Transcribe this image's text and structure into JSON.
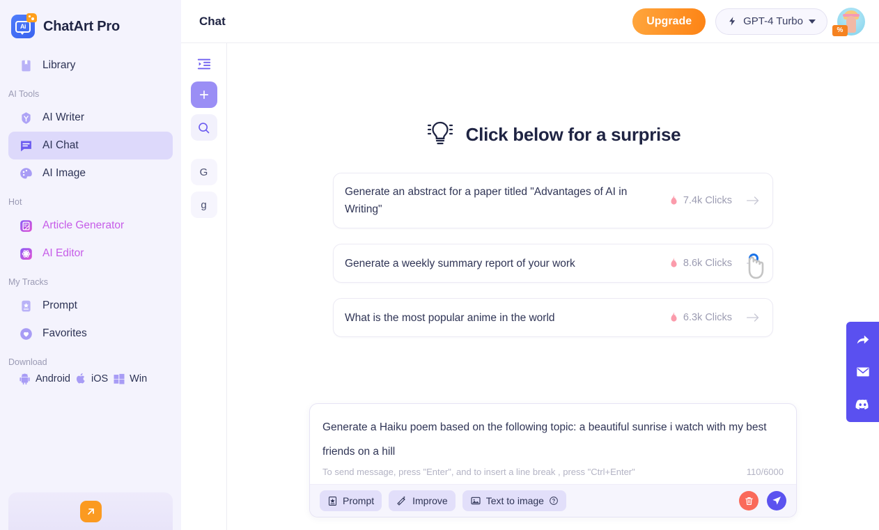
{
  "brand": {
    "name": "ChatArt Pro",
    "logo_icon": "ai-logo-icon"
  },
  "sidebar": {
    "library": {
      "label": "Library",
      "icon": "bookmark-icon"
    },
    "sections": [
      {
        "title": "AI Tools"
      },
      {
        "title": "Hot"
      },
      {
        "title": "My Tracks"
      },
      {
        "title": "Download"
      }
    ],
    "ai_tools": [
      {
        "label": "AI Writer",
        "icon": "writer-icon"
      },
      {
        "label": "AI Chat",
        "icon": "chat-bubble-icon",
        "active": true
      },
      {
        "label": "AI Image",
        "icon": "palette-icon"
      }
    ],
    "hot": [
      {
        "label": "Article Generator",
        "icon": "article-icon"
      },
      {
        "label": "AI Editor",
        "icon": "atom-icon"
      }
    ],
    "my_tracks": [
      {
        "label": "Prompt",
        "icon": "prompt-icon"
      },
      {
        "label": "Favorites",
        "icon": "heart-icon"
      }
    ],
    "download": [
      {
        "label": "Android",
        "icon": "android-icon"
      },
      {
        "label": "iOS",
        "icon": "apple-icon"
      },
      {
        "label": "Win",
        "icon": "windows-icon"
      }
    ],
    "promo": {
      "icon": "arrow-up-right-icon"
    }
  },
  "topbar": {
    "title": "Chat",
    "upgrade_label": "Upgrade",
    "model": {
      "label": "GPT-4 Turbo",
      "icon": "lightning-icon",
      "caret": "chevron-down-icon"
    },
    "avatar": {
      "name": "avatar",
      "badge": "%"
    }
  },
  "rail": {
    "collapse_icon": "collapse-panel-icon",
    "new_chat_icon": "plus-icon",
    "search_icon": "search-icon",
    "history": [
      {
        "label": "G"
      },
      {
        "label": "g"
      }
    ]
  },
  "main": {
    "heading": {
      "icon": "lightbulb-icon",
      "title": "Click below for a surprise"
    },
    "suggestions": [
      {
        "text": "Generate an abstract for a paper titled \"Advantages of AI in Writing\"",
        "clicks": "7.4k Clicks",
        "fire_icon": "flame-icon",
        "arrow_icon": "arrow-right-icon"
      },
      {
        "text": "Generate a weekly summary report of your work",
        "clicks": "8.6k Clicks",
        "fire_icon": "flame-icon",
        "arrow_icon": "arrow-right-icon"
      },
      {
        "text": "What is the most popular anime in the world",
        "clicks": "6.3k Clicks",
        "fire_icon": "flame-icon",
        "arrow_icon": "arrow-right-icon"
      }
    ]
  },
  "composer": {
    "value": "Generate a Haiku poem based on the following topic: a beautiful sunrise i watch with my best friends on a hill",
    "hint": "To send message, press \"Enter\", and to insert a line break , press \"Ctrl+Enter\"",
    "counter": "110/6000",
    "tools": [
      {
        "label": "Prompt",
        "icon": "prompt-box-icon"
      },
      {
        "label": "Improve",
        "icon": "magic-wand-icon"
      },
      {
        "label": "Text to image",
        "icon": "image-icon",
        "help_icon": "question-mark-icon"
      }
    ],
    "delete_icon": "trash-icon",
    "send_icon": "send-icon"
  },
  "dock": [
    {
      "icon": "share-icon"
    },
    {
      "icon": "mail-icon"
    },
    {
      "icon": "discord-icon"
    }
  ],
  "colors": {
    "sidebar_bg": "#f4f3fd",
    "accent": "#5b53ef",
    "active_item": "#ddd9fb",
    "upgrade_orange": "#fd8315",
    "hot_pink": "#c65ce8",
    "dock_blue": "#5a50f0",
    "delete_red": "#fa6a5a"
  }
}
